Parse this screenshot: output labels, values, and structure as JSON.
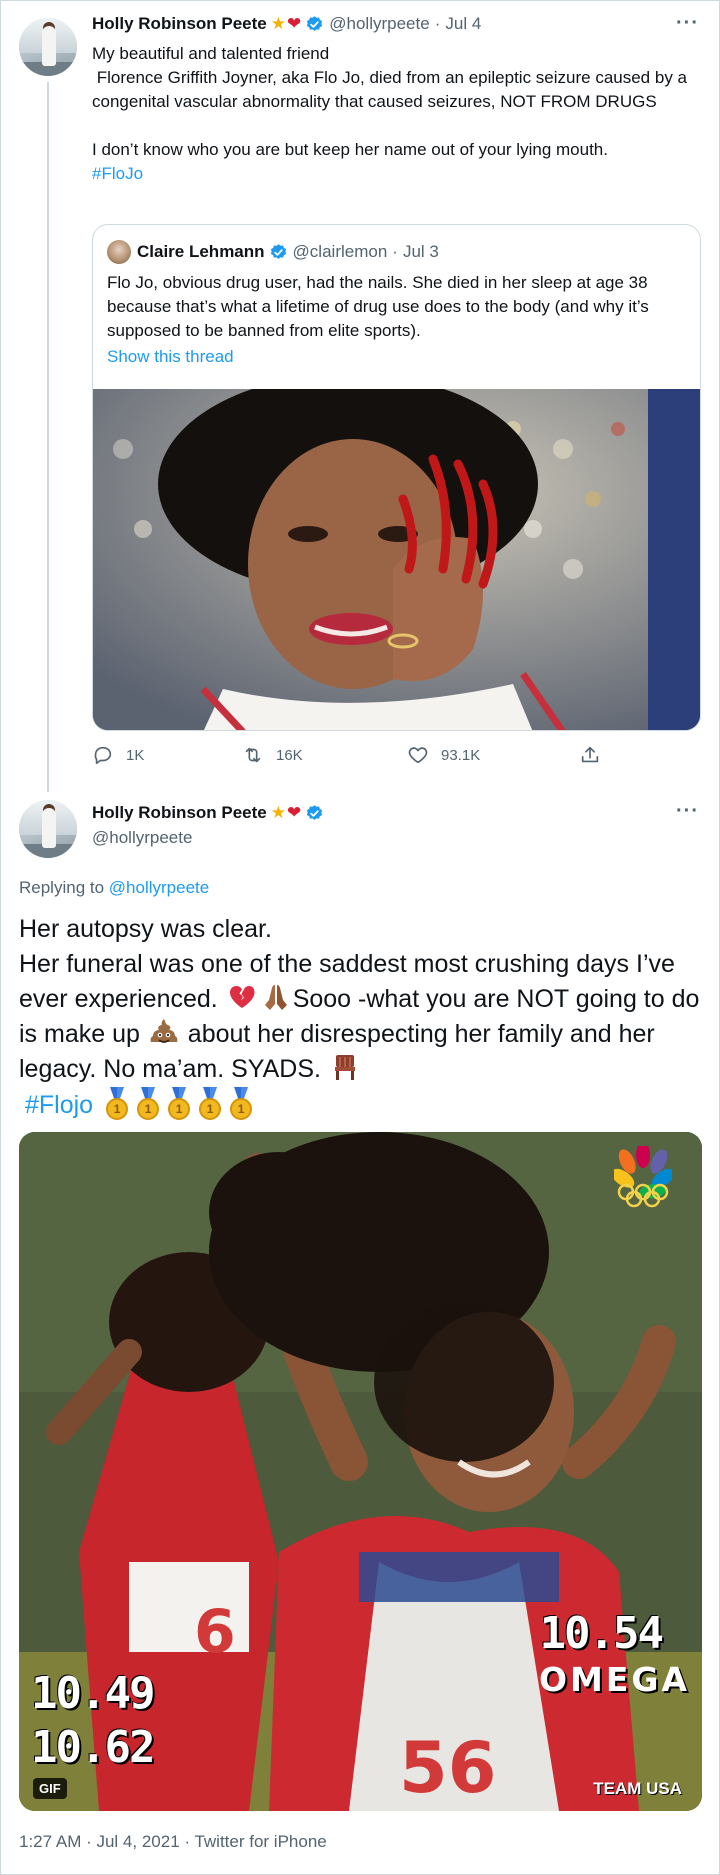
{
  "tweet1": {
    "author_name": "Holly Robinson Peete",
    "author_handle": "@hollyrpeete",
    "separator": "·",
    "date": "Jul 4",
    "more": "···",
    "text": "My beautiful and talented friend\n Florence Griffith Joyner, aka Flo Jo, died from an epileptic seizure caused by a congenital vascular abnormality that caused seizures, NOT FROM DRUGS\n\nI don’t know who you are but keep her name out of your lying mouth.",
    "hashtag": "#FloJo",
    "quote": {
      "author_name": "Claire Lehmann",
      "author_handle": "@clairlemon",
      "separator": "·",
      "date": "Jul 3",
      "text": "Flo Jo, obvious drug user, had the nails. She died in her sleep at age 38 because that’s what a lifetime of drug use does to the body (and why it’s supposed to be banned from elite sports).",
      "show_thread": "Show this thread"
    },
    "actions": {
      "replies": "1K",
      "retweets": "16K",
      "likes": "93.1K"
    }
  },
  "tweet2": {
    "author_name": "Holly Robinson Peete",
    "author_handle": "@hollyrpeete",
    "more": "···",
    "replying_prefix": "Replying to ",
    "replying_handle": "@hollyrpeete",
    "line1": "Her autopsy was clear.",
    "line2a": "Her funeral was one of the saddest most crushing days I’ve ever experienced.  ",
    "line2b": "Sooo -what you are NOT going to do is make up ",
    "line2c": " about her disrespecting her family and her legacy. No ma’am. SYADS. ",
    "hashtag": "#Flojo",
    "medal_digit": "1",
    "gif": {
      "time_left_1": "10.49",
      "time_left_2": "10.62",
      "time_right": "10.54",
      "brand": "OMEGA",
      "team": "TEAM USA",
      "badge": "GIF"
    },
    "footer": "1:27 AM · Jul 4, 2021 · Twitter for iPhone"
  },
  "colors": {
    "link": "#1d9bf0",
    "secondary": "#536471",
    "border": "#cfd9de",
    "verified": "#1d9bf0"
  },
  "icons": [
    "verified-badge-icon",
    "star-emoji",
    "heart-emoji",
    "reply-icon",
    "retweet-icon",
    "like-icon",
    "share-icon",
    "broken-heart-emoji",
    "praying-hands-emoji",
    "poop-emoji",
    "chair-emoji",
    "gold-medal-emoji",
    "nbc-peacock-logo",
    "olympic-rings-logo"
  ]
}
